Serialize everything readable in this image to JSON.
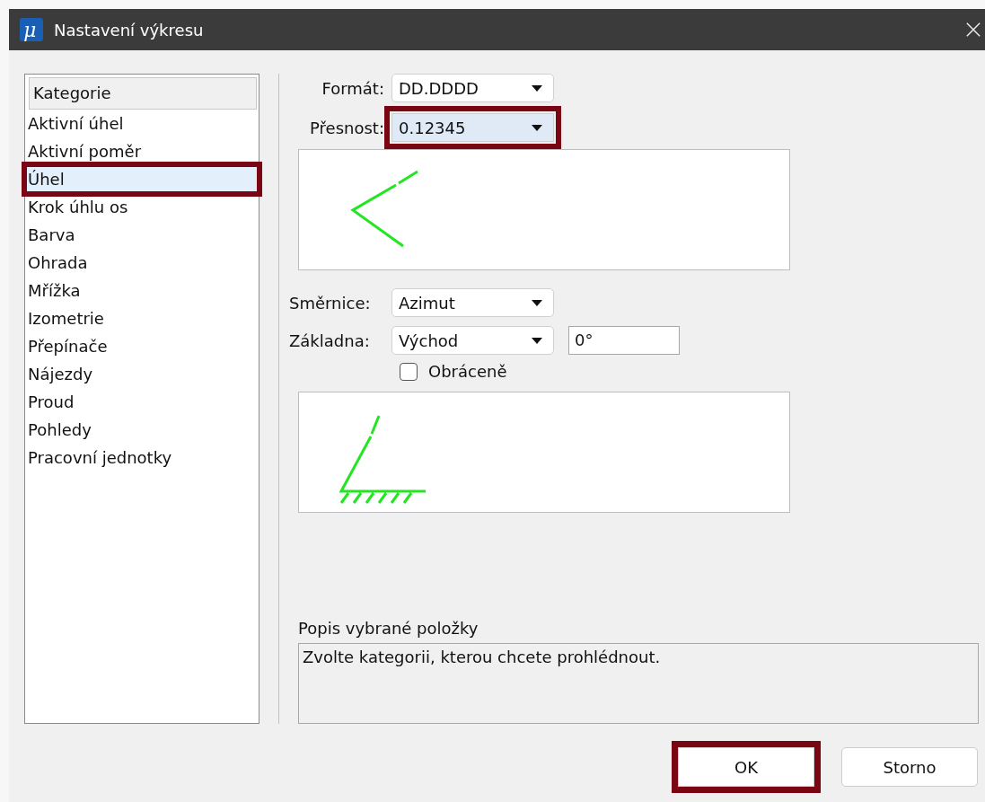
{
  "window": {
    "logo": "μ",
    "title": "Nastavení výkresu"
  },
  "category_list": {
    "header": "Kategorie",
    "items": [
      {
        "label": "Aktivní úhel",
        "selected": false,
        "highlighted": false
      },
      {
        "label": "Aktivní poměr",
        "selected": false,
        "highlighted": false
      },
      {
        "label": "Úhel",
        "selected": true,
        "highlighted": true
      },
      {
        "label": "Krok úhlu os",
        "selected": false,
        "highlighted": false
      },
      {
        "label": "Barva",
        "selected": false,
        "highlighted": false
      },
      {
        "label": "Ohrada",
        "selected": false,
        "highlighted": false
      },
      {
        "label": "Mřížka",
        "selected": false,
        "highlighted": false
      },
      {
        "label": "Izometrie",
        "selected": false,
        "highlighted": false
      },
      {
        "label": "Přepínače",
        "selected": false,
        "highlighted": false
      },
      {
        "label": "Nájezdy",
        "selected": false,
        "highlighted": false
      },
      {
        "label": "Proud",
        "selected": false,
        "highlighted": false
      },
      {
        "label": "Pohledy",
        "selected": false,
        "highlighted": false
      },
      {
        "label": "Pracovní jednotky",
        "selected": false,
        "highlighted": false
      }
    ]
  },
  "format_fields": [
    {
      "label": "Formát:",
      "value": "DD.DDDD",
      "focused": false,
      "highlighted": false
    },
    {
      "label": "Přesnost:",
      "value": "0.12345",
      "focused": true,
      "highlighted": true
    }
  ],
  "direction_fields": [
    {
      "label": "Směrnice:",
      "value": "Azimut"
    },
    {
      "label": "Základna:",
      "value": "Východ",
      "offset": "0°"
    }
  ],
  "reversed": {
    "label": "Obráceně",
    "checked": false
  },
  "description": {
    "label": "Popis vybrané položky",
    "text": "Zvolte kategorii, kterou chcete prohlédnout."
  },
  "buttons": [
    {
      "label": "OK",
      "highlighted": true
    },
    {
      "label": "Storno",
      "highlighted": false
    }
  ]
}
